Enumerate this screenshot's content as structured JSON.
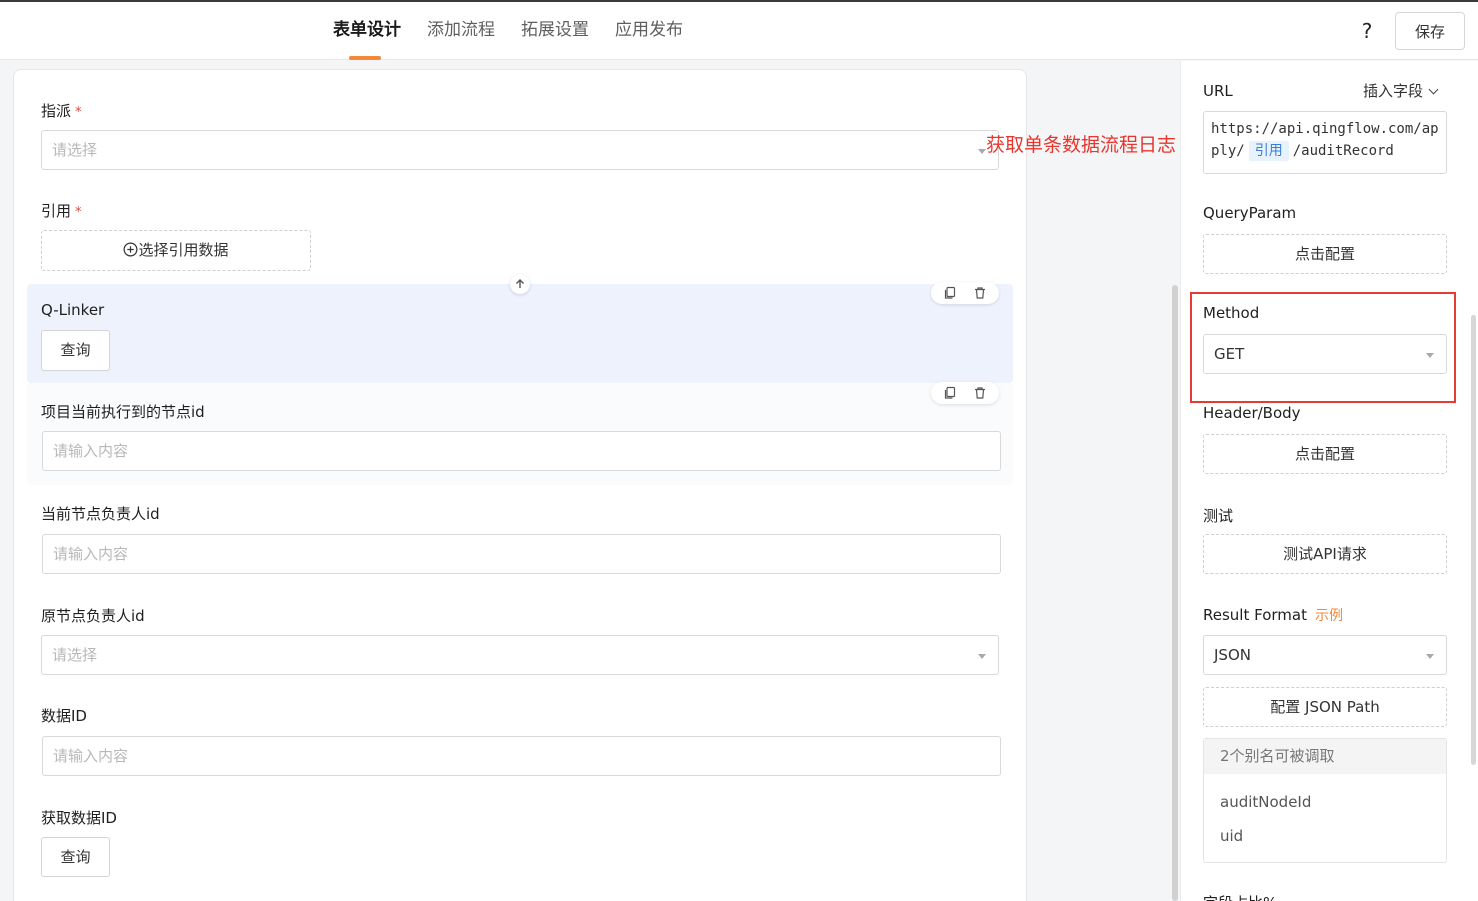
{
  "header": {
    "tabs": [
      {
        "label": "表单设计",
        "active": true
      },
      {
        "label": "添加流程",
        "active": false
      },
      {
        "label": "拓展设置",
        "active": false
      },
      {
        "label": "应用发布",
        "active": false
      }
    ],
    "help_label": "?",
    "save_label": "保存"
  },
  "form": {
    "assign": {
      "label": "指派",
      "required_mark": "*",
      "placeholder": "请选择"
    },
    "reference": {
      "label": "引用",
      "required_mark": "*",
      "button_label": "选择引用数据"
    },
    "qlinker": {
      "label": "Q-Linker",
      "button_label": "查询"
    },
    "node_id": {
      "label": "项目当前执行到的节点id",
      "placeholder": "请输入内容"
    },
    "owner_id": {
      "label": "当前节点负责人id",
      "placeholder": "请输入内容"
    },
    "orig_owner_id": {
      "label": "原节点负责人id",
      "placeholder": "请选择"
    },
    "data_id": {
      "label": "数据ID",
      "placeholder": "请输入内容"
    },
    "get_data_id": {
      "label": "获取数据ID",
      "button_label": "查询"
    }
  },
  "annotation": "获取单条数据流程日志",
  "panel": {
    "url_label": "URL",
    "insert_field_label": "插入字段",
    "url_prefix": "https://api.qingflow.com/apply/",
    "url_ref_chip": "引用",
    "url_suffix": "/auditRecord",
    "query_param_label": "QueryParam",
    "query_param_button": "点击配置",
    "method_label": "Method",
    "method_value": "GET",
    "header_body_label": "Header/Body",
    "header_body_button": "点击配置",
    "test_label": "测试",
    "test_button": "测试API请求",
    "result_format_label": "Result Format",
    "result_example_link": "示例",
    "result_format_value": "JSON",
    "json_path_button": "配置 JSON Path",
    "alias_header": "2个别名可被调取",
    "aliases": [
      "auditNodeId",
      "uid"
    ],
    "bottom_label_partial": "字段占比%"
  },
  "colors": {
    "accent": "#f5873a",
    "annotation": "#e8362d",
    "selected_bg": "#eef2fc",
    "ref_chip": "#3a7fd1"
  }
}
